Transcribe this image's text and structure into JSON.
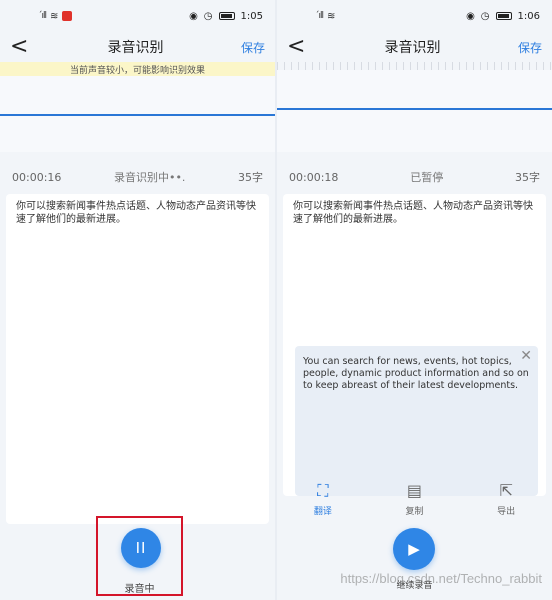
{
  "left": {
    "status": {
      "time": "1:05",
      "signal": "´ıll"
    },
    "nav": {
      "back": "<",
      "title": "录音识别",
      "save": "保存"
    },
    "tip": "当前声音较小，可能影响识别效果",
    "info": {
      "elapsed": "00:00:16",
      "state": "录音识别中••.",
      "count": "35字"
    },
    "text": "你可以搜索新闻事件热点话题、人物动态产品资讯等快速了解他们的最新进展。",
    "record": {
      "icon": "II",
      "label": "录音中"
    }
  },
  "right": {
    "status": {
      "time": "1:06",
      "signal": "´ıll"
    },
    "nav": {
      "back": "<",
      "title": "录音识别",
      "save": "保存"
    },
    "info": {
      "elapsed": "00:00:18",
      "state": "已暂停",
      "count": "35字"
    },
    "text": "你可以搜索新闻事件热点话题、人物动态产品资讯等快速了解他们的最新进展。",
    "translation": "You can search for news, events, hot topics, people, dynamic product information and so on to keep abreast of their latest developments.",
    "tools": [
      {
        "icon": "scan-translate-icon",
        "label": "翻译"
      },
      {
        "icon": "copy-icon",
        "label": "复制"
      },
      {
        "icon": "export-icon",
        "label": "导出"
      }
    ],
    "play": {
      "icon": "▶",
      "label": "继续录音"
    }
  },
  "watermark": "https://blog.csdn.net/Techno_rabbit"
}
